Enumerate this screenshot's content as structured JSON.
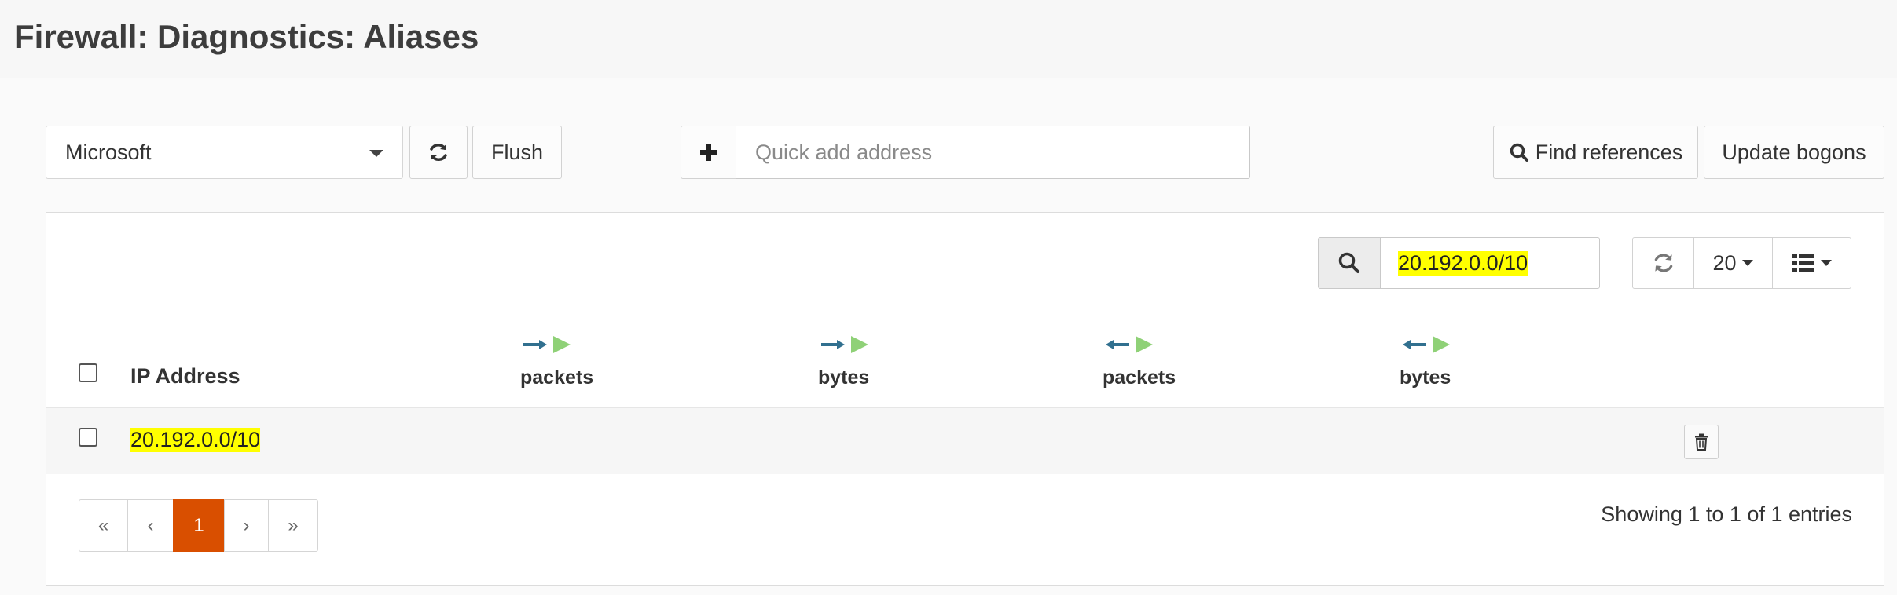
{
  "header": {
    "title": "Firewall: Diagnostics: Aliases"
  },
  "toolbar": {
    "alias_selected": "Microsoft",
    "flush_label": "Flush",
    "quick_add_placeholder": "Quick add address",
    "find_references_label": "Find references",
    "update_bogons_label": "Update bogons"
  },
  "grid": {
    "search_value": "20.192.0.0/10",
    "page_size": "20",
    "columns": {
      "ip_address": "IP Address",
      "in_packets": "packets",
      "in_bytes": "bytes",
      "out_packets": "packets",
      "out_bytes": "bytes"
    },
    "rows": [
      {
        "ip": "20.192.0.0/10"
      }
    ],
    "pager": {
      "first": "«",
      "prev": "‹",
      "current": "1",
      "next": "›",
      "last": "»"
    },
    "status": "Showing 1 to 1 of 1 entries"
  },
  "colors": {
    "accent": "#d94f00",
    "arrow_blue": "#31708f",
    "arrow_green": "#8fd177",
    "highlight": "#ffff00"
  }
}
